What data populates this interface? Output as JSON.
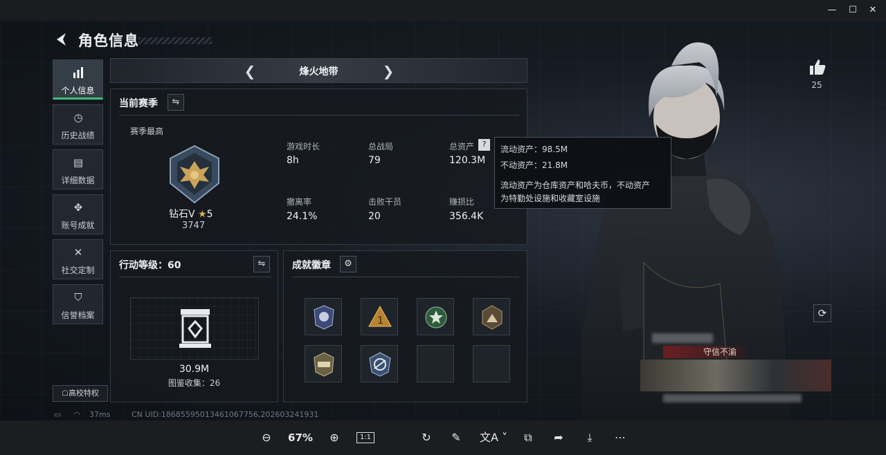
{
  "window": {
    "minimize": "—",
    "maximize": "☐",
    "close": "✕"
  },
  "page": {
    "title": "角色信息"
  },
  "nav": [
    {
      "label": "个人信息",
      "icon": "bar-chart-icon",
      "active": true
    },
    {
      "label": "历史战绩",
      "icon": "clock-icon"
    },
    {
      "label": "详细数据",
      "icon": "folder-icon"
    },
    {
      "label": "账号成就",
      "icon": "medal-icon"
    },
    {
      "label": "社交定制",
      "icon": "tools-icon"
    },
    {
      "label": "信誉档案",
      "icon": "shield-icon"
    }
  ],
  "school_btn": "高校特权",
  "map": {
    "name": "烽火地带"
  },
  "season": {
    "title": "当前赛季",
    "best_label": "赛季最高",
    "rank": "钻石V",
    "stars": "5",
    "score": "3747",
    "stats": [
      {
        "label": "游戏时长",
        "value": "8h"
      },
      {
        "label": "总战局",
        "value": "79"
      },
      {
        "label": "总资产",
        "value": "120.3M"
      },
      {
        "label": "撤离率",
        "value": "24.1%"
      },
      {
        "label": "击败干员",
        "value": "20"
      },
      {
        "label": "赚损比",
        "value": "356.4K"
      }
    ]
  },
  "tooltip": {
    "line1": "流动资产：98.5M",
    "line2": "不动资产：21.8M",
    "desc1": "流动资产为仓库资产和哈夫币，不动资产",
    "desc2": "为特勤处设施和收藏室设施"
  },
  "level": {
    "title": "行动等级：60",
    "value": "30.9M",
    "collection": "图鉴收集：26"
  },
  "badges": {
    "title": "成就徽章"
  },
  "likes": "25",
  "player_card": {
    "vow": "守信不渝"
  },
  "status": {
    "ping": "37ms",
    "uid": "CN UID:18685595013461067756,202603241931"
  },
  "viewer": {
    "zoom": "67%",
    "ratio": "1:1"
  }
}
